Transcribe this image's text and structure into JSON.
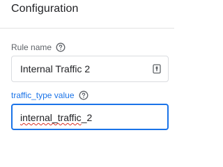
{
  "header": {
    "title": "Configuration"
  },
  "rule_name": {
    "label": "Rule name",
    "value": "Internal Traffic 2"
  },
  "traffic_type": {
    "label": "traffic_type value",
    "value_misspelled": "internal_traffic",
    "value_rest": "_2"
  },
  "icons": {
    "help": "help-circle-icon",
    "autofill": "password-manager-icon"
  },
  "colors": {
    "accent": "#1a73e8",
    "label": "#5f6368",
    "text": "#202124",
    "border": "#dadce0",
    "spell_error": "#d93025"
  }
}
